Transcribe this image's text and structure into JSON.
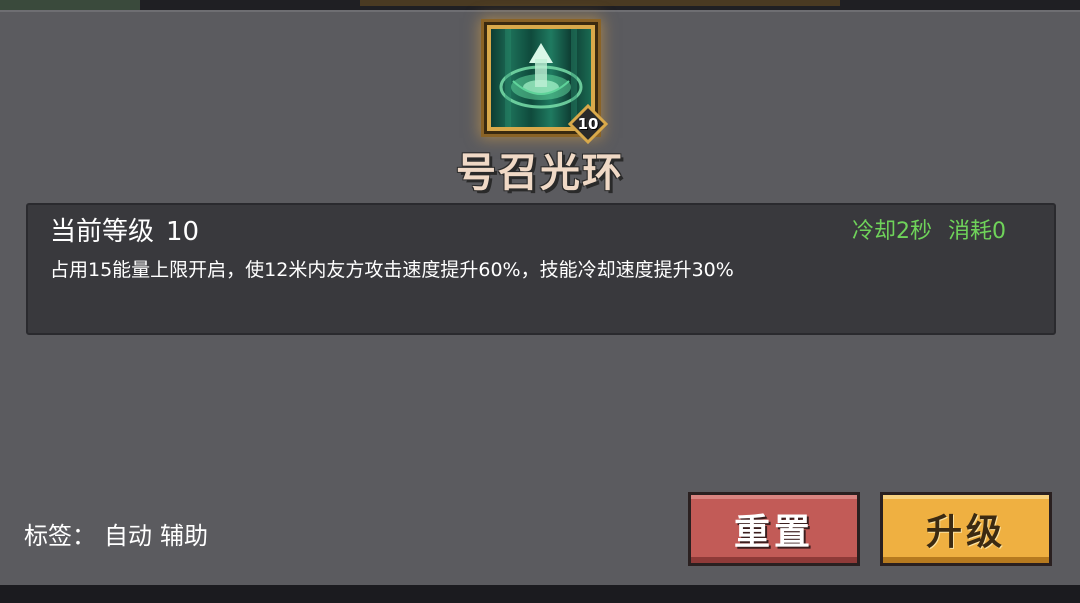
{
  "skill": {
    "name": "号召光环",
    "level_badge": "10",
    "icon": "summon-aura-icon"
  },
  "details": {
    "level_label": "当前等级",
    "level_value": "10",
    "cooldown": "冷却2秒",
    "cost": "消耗0",
    "description": "占用15能量上限开启，使12米内友方攻击速度提升60%，技能冷却速度提升30%"
  },
  "tags": {
    "label": "标签：",
    "items": [
      "自动",
      "辅助"
    ]
  },
  "buttons": {
    "reset": "重置",
    "upgrade": "升级"
  },
  "colors": {
    "panel": "#5b5b5f",
    "desc_box": "#39393d",
    "cooldown_text": "#6fd35a",
    "reset_button": "#c25b57",
    "upgrade_button": "#efb041",
    "title_text": "#f0d9c6",
    "icon_frame": "#d9a94a"
  }
}
